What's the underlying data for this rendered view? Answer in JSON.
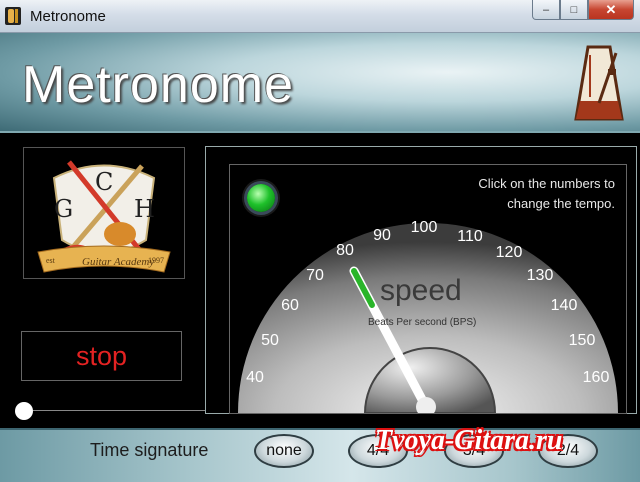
{
  "window": {
    "title": "Metronome",
    "minimize_glyph": "–",
    "maximize_glyph": "□",
    "close_glyph": "✕"
  },
  "header": {
    "title": "Metronome",
    "icon": "metronome-icon"
  },
  "logo": {
    "letters": [
      "G",
      "C",
      "H"
    ],
    "ribbon_text": "Guitar Academy",
    "ribbon_left": "est",
    "ribbon_right": "1997"
  },
  "controls": {
    "stop_label": "stop"
  },
  "gauge": {
    "hint_line1": "Click on the numbers to",
    "hint_line2": "change the tempo.",
    "speed_label": "speed",
    "units_label": "Beats Per second (BPS)",
    "ticks": [
      "40",
      "50",
      "60",
      "70",
      "80",
      "90",
      "100",
      "110",
      "120",
      "130",
      "140",
      "150",
      "160"
    ],
    "current_value": 80,
    "led_color": "#1ec12a"
  },
  "footer": {
    "time_signature_label": "Time signature",
    "options": [
      "none",
      "4/4",
      "3/4",
      "2/4"
    ],
    "watermark": "Tvoya-Gitara.ru"
  }
}
